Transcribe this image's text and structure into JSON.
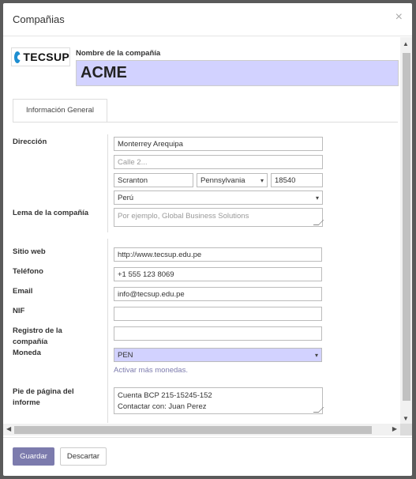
{
  "dialog": {
    "title": "Compañias",
    "close_glyph": "×"
  },
  "logo": {
    "text": "TECSUP"
  },
  "company": {
    "name_label": "Nombre de la compañía",
    "name_value": "ACME"
  },
  "tabs": [
    {
      "label": "Información General",
      "active": true
    }
  ],
  "labels": {
    "address": "Dirección",
    "slogan": "Lema de la compañía",
    "website": "Sitio web",
    "phone": "Teléfono",
    "email": "Email",
    "nif": "NIF",
    "registry": "Registro de la compañía",
    "currency": "Moneda",
    "footer": "Pie de página del informe"
  },
  "fields": {
    "street": "Monterrey Arequipa",
    "street2_placeholder": "Calle 2...",
    "city": "Scranton",
    "state": "Pennsylvania",
    "zip": "18540",
    "country": "Perú",
    "slogan_placeholder": "Por ejemplo, Global Business Solutions",
    "website": "http://www.tecsup.edu.pe",
    "phone": "+1 555 123 8069",
    "email": "info@tecsup.edu.pe",
    "nif": "",
    "registry": "",
    "currency": "PEN",
    "footer_line1": "Cuenta BCP 215-15245-152",
    "footer_line2": "Contactar con: Juan Perez"
  },
  "links": {
    "activate_currencies": "Activar más monedas."
  },
  "buttons": {
    "save": "Guardar",
    "discard": "Descartar"
  },
  "colors": {
    "accent": "#7c7bad",
    "highlight": "#d2d2ff"
  }
}
